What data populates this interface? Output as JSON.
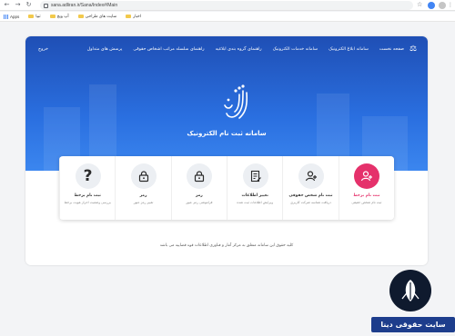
{
  "browser": {
    "url": "sana.adliran.ir/Sana/Index#/Main",
    "bookmarks": [
      {
        "label": "Apps"
      },
      {
        "label": "تبیا"
      },
      {
        "label": "آپ ویج"
      },
      {
        "label": "سایت های طراحی"
      },
      {
        "label": "اخبار"
      }
    ]
  },
  "site": {
    "nav": [
      {
        "label": "صفحه نخست"
      },
      {
        "label": "سامانه ابلاغ الکترونیک"
      },
      {
        "label": "سامانه خدمات الکترونیک"
      },
      {
        "label": "راهنمای گروه بندی ابلاغیه"
      },
      {
        "label": "راهنمای سلسله مراتب اشخاص حقوقی"
      },
      {
        "label": "پرسش های متداول"
      }
    ],
    "exit_label": "خروج",
    "hero_title": "سامانه ثبت نام الکترونیک",
    "cards": [
      {
        "title": "ثبت نام برخط",
        "subtitle": "ثبت نام شخص حقیقی",
        "icon": "user-add-icon",
        "accent": "#e5316b"
      },
      {
        "title": "ثبت نام شخص حقوقی",
        "subtitle": "دریافت شناسه شرکت کاربری",
        "icon": "user-plus-icon",
        "accent": ""
      },
      {
        "title": "تغییر اطلاعات",
        "subtitle": "ویرایش اطلاعات ثبت شده",
        "icon": "edit-document-icon",
        "accent": ""
      },
      {
        "title": "رمز",
        "subtitle": "فراموشی رمز عبور",
        "icon": "lock-icon",
        "accent": ""
      },
      {
        "title": "رمز",
        "subtitle": "تغییر رمز عبور",
        "icon": "lock-icon",
        "accent": ""
      },
      {
        "title": "ثبت نام برخط",
        "subtitle": "بررسی وضعیت احراز هویت برخط",
        "icon": "question-icon",
        "accent": ""
      }
    ],
    "footer_note": "کلیه حقوق این سامانه متعلق به مرکز آمار و فناوری اطلاعات قوه قضاییه می باشد"
  },
  "watermark": {
    "label": "سایت حقوقی دینا"
  },
  "colors": {
    "hero": "#2a6fe0",
    "accent_pink": "#e5316b",
    "watermark_bg": "#1d3d8c"
  }
}
